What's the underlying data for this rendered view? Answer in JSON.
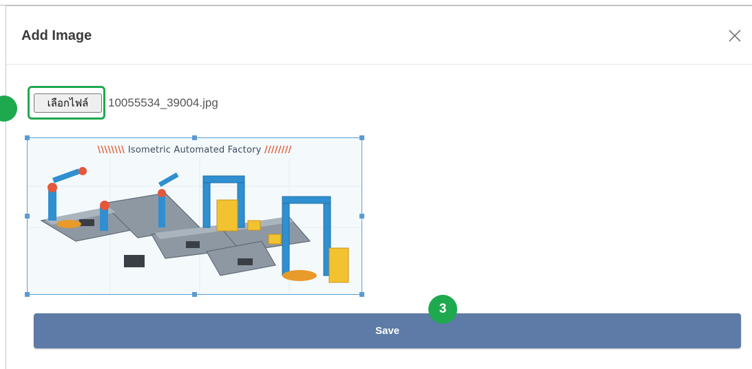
{
  "dialog": {
    "title": "Add Image",
    "close_icon": "close-icon"
  },
  "file_input": {
    "button_label": "เลือกไฟล์",
    "file_name": "10055534_39004.jpg"
  },
  "image_preview": {
    "caption_text": "Isometric Automated Factory",
    "caption_stripes": "\\\\\\\\\\\\\\\\"
  },
  "step_markers": {
    "save_step": "3"
  },
  "actions": {
    "save_label": "Save"
  },
  "colors": {
    "accent_green": "#1ea94e",
    "save_button": "#5d7ba6",
    "selection_blue": "#5b9bd5"
  }
}
